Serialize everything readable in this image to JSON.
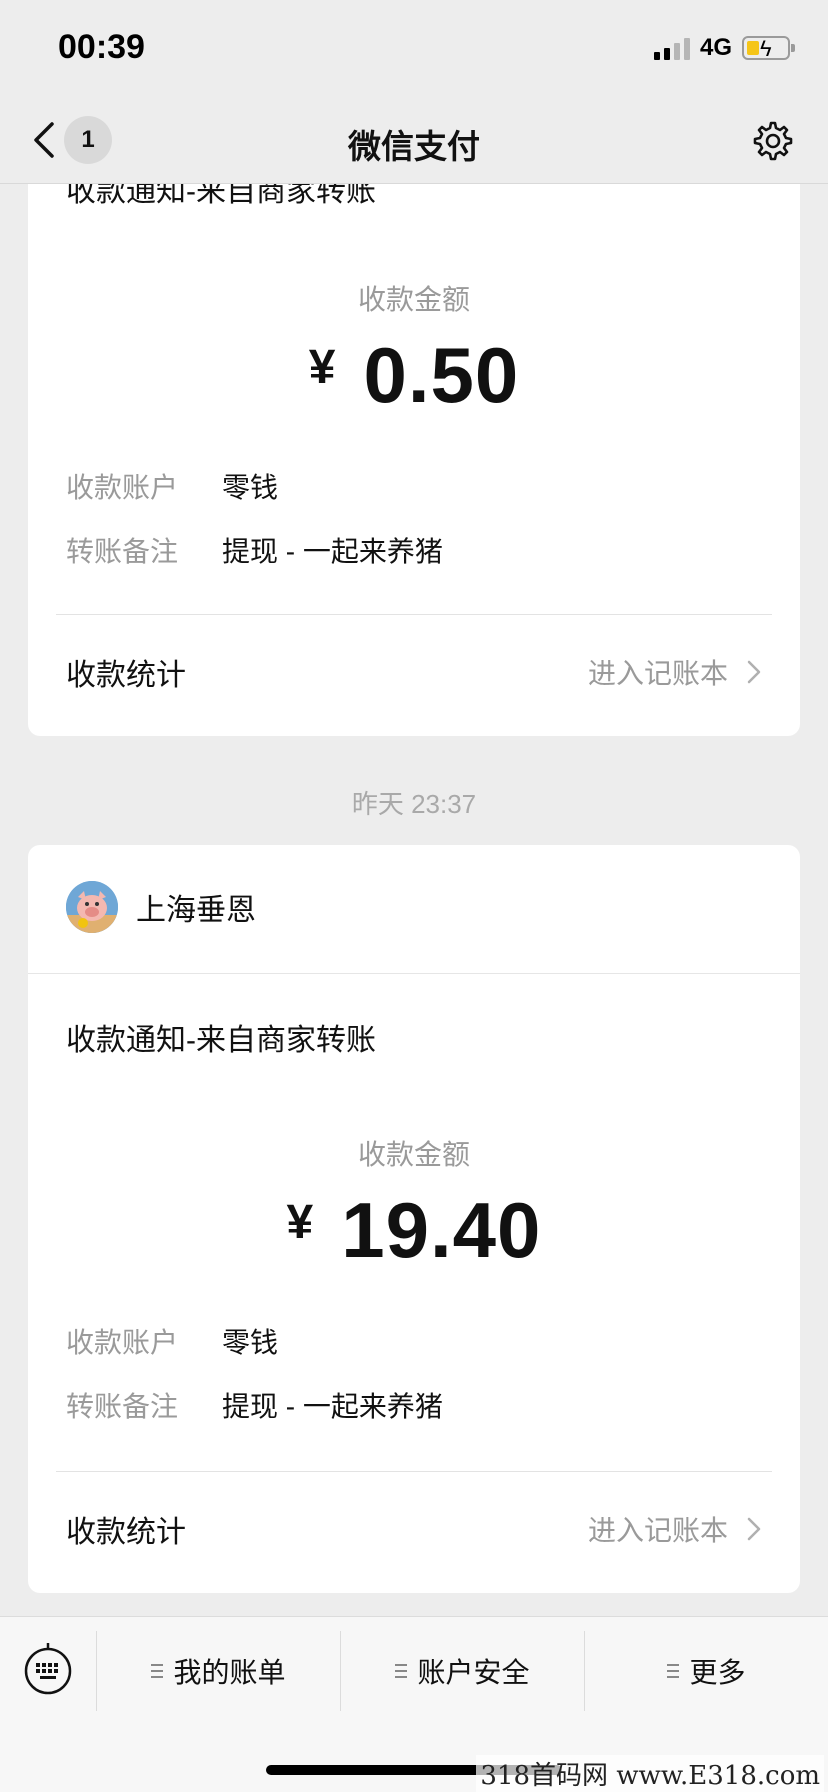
{
  "status": {
    "time": "00:39",
    "network": "4G"
  },
  "nav": {
    "badge": "1",
    "title": "微信支付"
  },
  "card1": {
    "notice_title": "收款通知-来自商家转账",
    "amount_label": "收款金额",
    "currency": "¥",
    "amount": "0.50",
    "rows": [
      {
        "key": "收款账户",
        "value": "零钱"
      },
      {
        "key": "转账备注",
        "value": "提现 - 一起来养猪"
      }
    ],
    "stat_label": "收款统计",
    "stat_link": "进入记账本"
  },
  "timestamp": "昨天 23:37",
  "card2": {
    "merchant_name": "上海垂恩",
    "notice_title": "收款通知-来自商家转账",
    "amount_label": "收款金额",
    "currency": "¥",
    "amount": "19.40",
    "rows": [
      {
        "key": "收款账户",
        "value": "零钱"
      },
      {
        "key": "转账备注",
        "value": "提现 - 一起来养猪"
      }
    ],
    "stat_label": "收款统计",
    "stat_link": "进入记账本"
  },
  "bottom_menu": [
    {
      "label": "我的账单"
    },
    {
      "label": "账户安全"
    },
    {
      "label": "更多"
    }
  ],
  "watermark": "318首码网 www.E318.com",
  "colors": {
    "battery_fill": "#f5c518",
    "background": "#ededed",
    "muted_text": "#9a9a9a"
  }
}
